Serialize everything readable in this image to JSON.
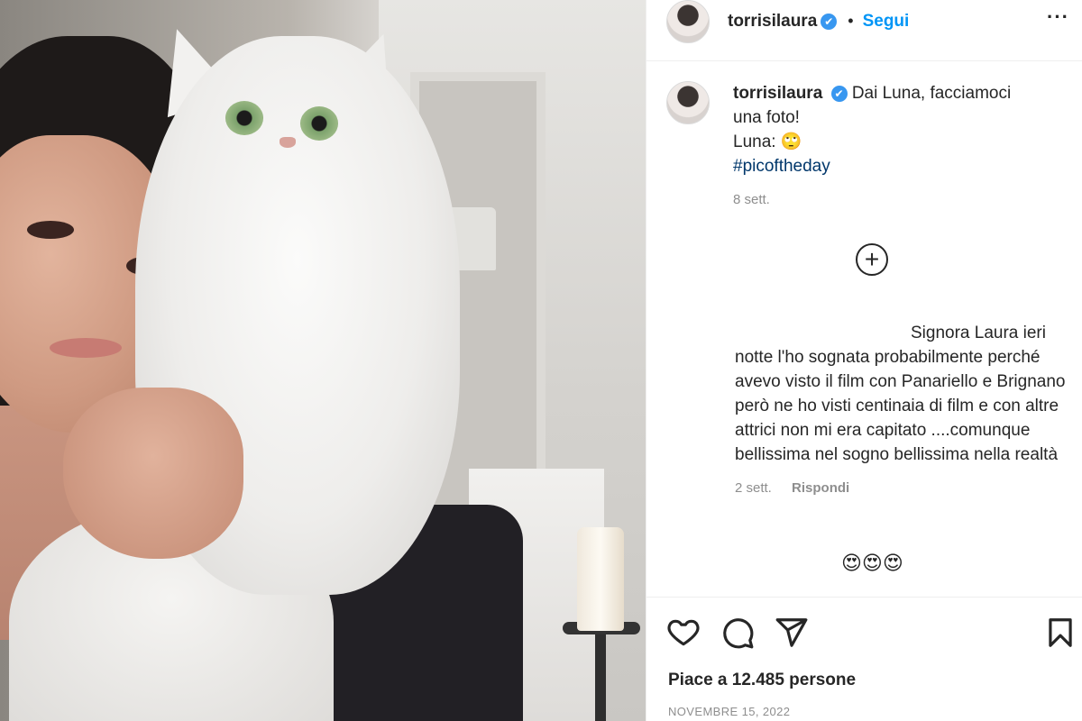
{
  "post": {
    "image_alt": "Woman with white long-haired cat",
    "author": {
      "username": "torrisilaura",
      "verified_mark": "✔",
      "separator": "•",
      "follow_label": "Segui",
      "more_label": "···"
    },
    "caption": {
      "username": "torrisilaura",
      "line1": "Dai Luna, facciamoci",
      "line2": "una foto!",
      "line3": "Luna: 🙄",
      "hashtag": "#picoftheday",
      "time": "8 sett."
    },
    "load_more_label": "+",
    "comments": [
      {
        "text_line1": "Signora Laura ieri",
        "text_rest": "notte l'ho sognata probabilmente perché avevo visto il film con Panariello e Brignano però ne ho visti centinaia di film e con altre attrici non mi era capitato ....comunque bellissima nel sogno bellissima nella realtà",
        "time": "2 sett.",
        "reply_label": "Rispondi"
      },
      {
        "text": "😍😍😍"
      }
    ],
    "likes_text": "Piace a 12.485 persone",
    "date": "NOVEMBRE 15, 2022"
  },
  "icons": {
    "like": "heart-icon",
    "comment": "speech-bubble-icon",
    "share": "paper-plane-icon",
    "save": "bookmark-icon",
    "more": "ellipsis-icon",
    "add": "plus-circle-icon"
  },
  "colors": {
    "link_blue": "#0095f6",
    "hashtag": "#00376b",
    "muted": "#8e8e8e",
    "verified": "#3897f0"
  }
}
